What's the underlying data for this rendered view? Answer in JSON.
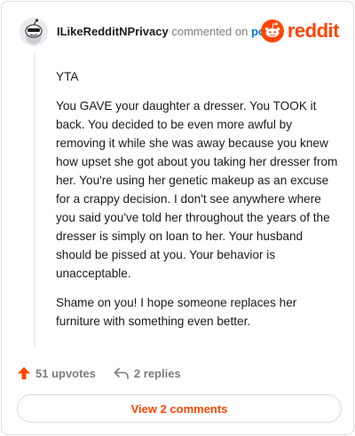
{
  "header": {
    "username": "ILikeRedditNPrivacy",
    "commented_on": "commented on",
    "post_link": "post",
    "brand": "reddit"
  },
  "comment": {
    "paragraphs": [
      "YTA",
      "You GAVE your daughter a dresser. You TOOK it back. You decided to be even more awful by removing it while she was away because you knew how upset she got about you taking her dresser from her. You're using her genetic makeup as an excuse for a crappy decision. I don't see anywhere where you said you've told her throughout the years of the dresser is simply on loan to her. Your husband should be pissed at you. Your behavior is unacceptable.",
      "Shame on you! I hope someone replaces her furniture with something even better."
    ]
  },
  "actions": {
    "upvotes": "51 upvotes",
    "replies": "2 replies"
  },
  "footer": {
    "view_comments": "View 2 comments"
  },
  "colors": {
    "brand": "#ff4500",
    "link": "#0079d3",
    "muted": "#7c7c7c"
  },
  "icons": {
    "avatar": "snoo-avatar-icon",
    "logo": "reddit-logo-icon",
    "upvote": "upvote-arrow-icon",
    "reply": "reply-arrow-icon"
  }
}
